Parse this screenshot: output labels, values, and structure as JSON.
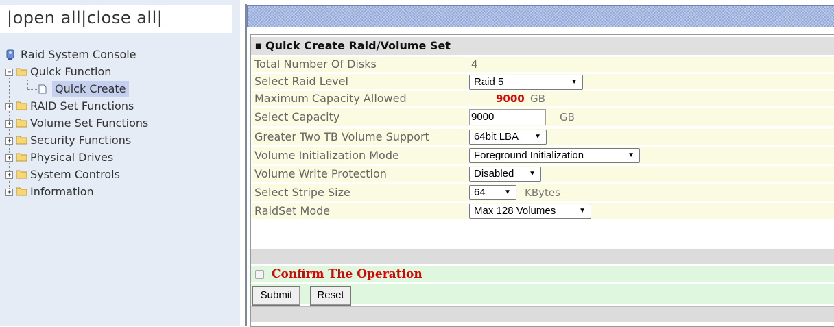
{
  "tree": {
    "open_all": "open all",
    "close_all": "close all",
    "sep_left": "|",
    "sep_mid": "|",
    "sep_right": "|",
    "root_label": "Raid System Console",
    "items": [
      {
        "label": "Quick Function",
        "expanded": true
      },
      {
        "label": "Quick Create",
        "selected": true
      },
      {
        "label": "RAID Set Functions"
      },
      {
        "label": "Volume Set Functions"
      },
      {
        "label": "Security Functions"
      },
      {
        "label": "Physical Drives"
      },
      {
        "label": "System Controls"
      },
      {
        "label": "Information"
      }
    ]
  },
  "form": {
    "title": "Quick Create Raid/Volume Set",
    "rows": {
      "total_disks": {
        "label": "Total Number Of Disks",
        "value": "4"
      },
      "raid_level": {
        "label": "Select Raid Level",
        "value": "Raid 5"
      },
      "max_capacity": {
        "label": "Maximum Capacity Allowed",
        "value": "9000",
        "unit": "GB"
      },
      "select_capacity": {
        "label": "Select Capacity",
        "value": "9000",
        "unit": "GB"
      },
      "greater_two_tb": {
        "label": "Greater Two TB Volume Support",
        "value": "64bit LBA"
      },
      "init_mode": {
        "label": "Volume Initialization Mode",
        "value": "Foreground Initialization"
      },
      "write_protect": {
        "label": "Volume Write Protection",
        "value": "Disabled"
      },
      "stripe_size": {
        "label": "Select Stripe Size",
        "value": "64",
        "unit": "KBytes"
      },
      "raidset_mode": {
        "label": "RaidSet Mode",
        "value": "Max 128 Volumes"
      }
    },
    "confirm_label": "Confirm The Operation",
    "confirm_checked": false,
    "submit_label": "Submit",
    "reset_label": "Reset"
  },
  "colors": {
    "accent_red": "#e00000",
    "label_bg": "#fbfbe1",
    "confirm_bg": "#dff7df",
    "header_band": "#8fa6d8"
  },
  "icons": {
    "root": "raid-console-icon",
    "folder": "folder-icon",
    "document": "document-icon",
    "dropdown": "dropdown-arrow-icon"
  }
}
